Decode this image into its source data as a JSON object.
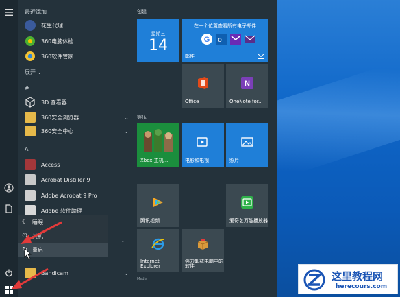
{
  "rail": {
    "icons": [
      "menu-icon",
      "user-icon",
      "document-icon",
      "power-icon",
      "windows-icon"
    ]
  },
  "app_list": {
    "recent_header": "最近添加",
    "recent": [
      {
        "label": "花生代理",
        "icon": "peanut-proxy-icon",
        "color": "#3a5a9c"
      },
      {
        "label": "360电脑体检",
        "icon": "360-check-icon",
        "color": "#4caf32"
      },
      {
        "label": "360软件管家",
        "icon": "360-software-icon",
        "color": "#f3c334"
      }
    ],
    "expand_label": "展开 ⌄",
    "hash_header": "#",
    "hash_items": [
      {
        "label": "3D 查看器",
        "icon": "3d-viewer-icon"
      },
      {
        "label": "360安全浏览器",
        "icon": "folder-icon"
      },
      {
        "label": "360安全中心",
        "icon": "folder-icon"
      }
    ],
    "a_header": "A",
    "a_items": [
      {
        "label": "Access",
        "icon": "access-icon",
        "color": "#a4373a"
      },
      {
        "label": "Acrobat Distiller 9",
        "icon": "acrobat-distiller-icon",
        "color": "#c8c8c8"
      },
      {
        "label": "Adobe Acrobat 9 Pro",
        "icon": "acrobat-icon",
        "color": "#d0d0d0"
      },
      {
        "label": "Adobe 软件助理",
        "icon": "adobe-helper-icon",
        "color": "#d8d8d8"
      }
    ],
    "bandicam": {
      "label": "Bandicam",
      "icon": "folder-icon"
    }
  },
  "power_menu": {
    "items": [
      {
        "label": "睡眠",
        "icon": "sleep-icon"
      },
      {
        "label": "关机",
        "icon": "power-icon"
      },
      {
        "label": "重启",
        "icon": "restart-icon"
      }
    ]
  },
  "tiles": {
    "create_header": "创建",
    "play_header": "娱乐",
    "calendar": {
      "weekday": "星期三",
      "day": "14"
    },
    "mail": {
      "top_text": "在一个位置查看所有电子邮件",
      "label": "邮件"
    },
    "office": {
      "label": "Office"
    },
    "onenote": {
      "label": "OneNote for..."
    },
    "xbox": {
      "label": "Xbox 主机..."
    },
    "movies": {
      "label": "电影和电视"
    },
    "photos": {
      "label": "照片"
    },
    "tencent_video": {
      "label": "腾讯视频"
    },
    "iqiyi": {
      "label": "爱奇艺万能播放器"
    },
    "ie": {
      "label": "Internet Explorer"
    },
    "uninstall": {
      "label": "强力卸载电脑中的软件"
    },
    "bottom_label": "Media"
  },
  "watermark": {
    "title": "这里教程网",
    "url": "herecours.com"
  },
  "colors": {
    "accent": "#1f7fd8",
    "annotation": "#e23a3a"
  }
}
